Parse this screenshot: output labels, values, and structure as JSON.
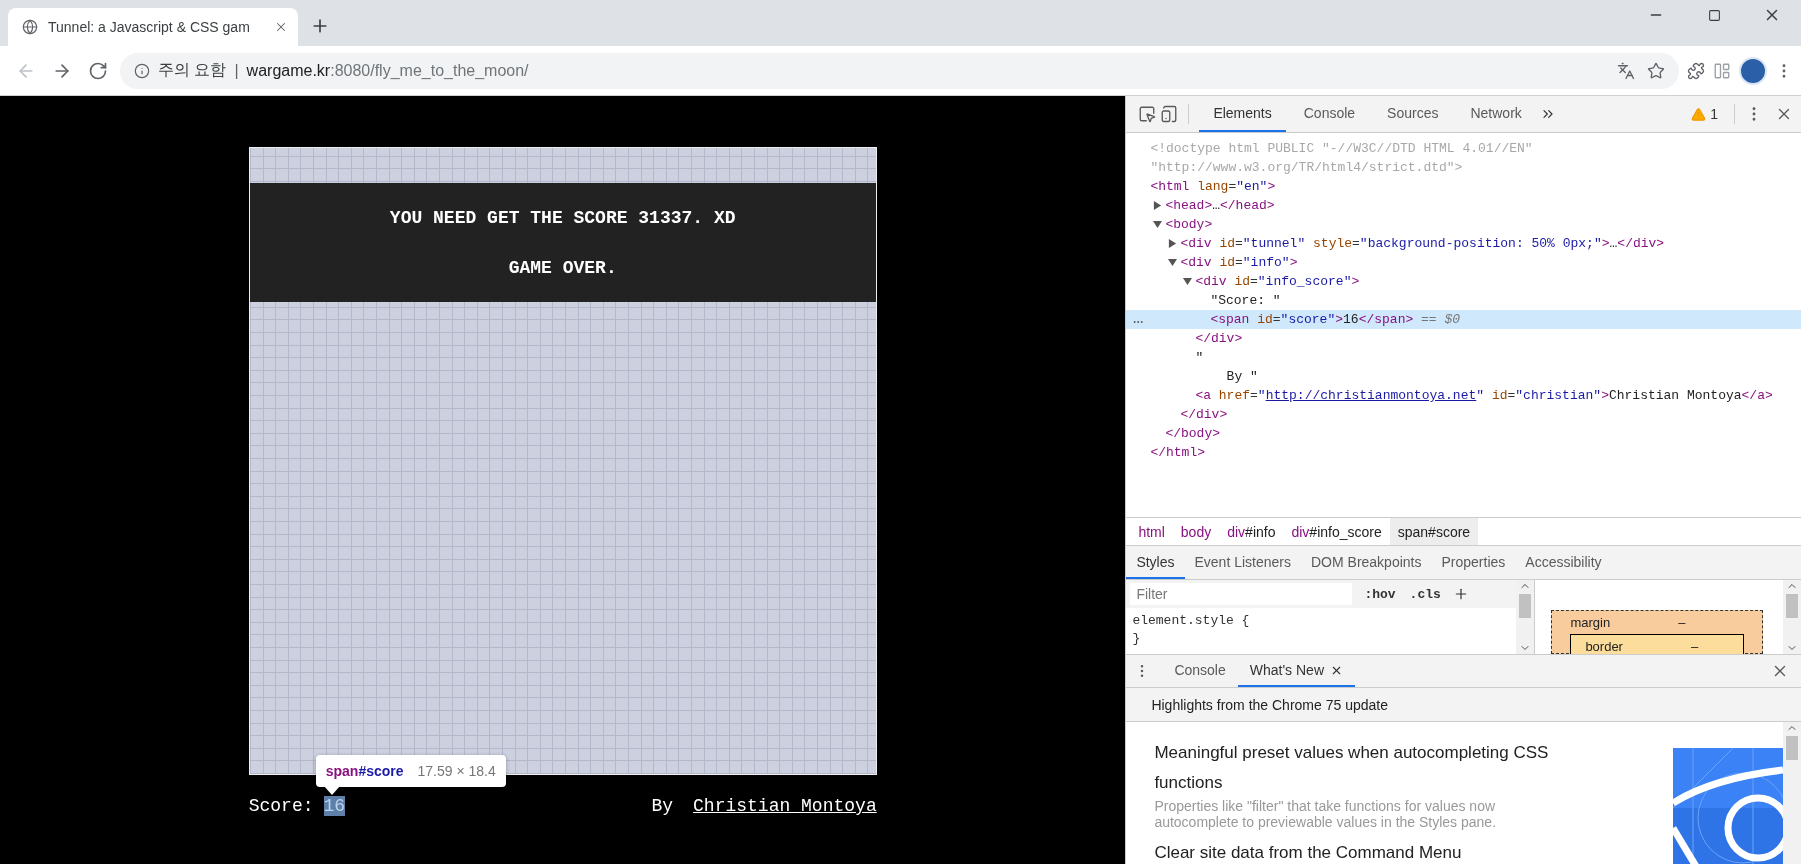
{
  "browser": {
    "tab": {
      "title": "Tunnel: a Javascript & CSS gam"
    },
    "nav": [
      {
        "kind": "back",
        "disabled": true
      },
      {
        "kind": "forward",
        "disabled": false
      },
      {
        "kind": "reload",
        "disabled": false
      }
    ],
    "address": {
      "warning": "주의 요함",
      "separator": "|",
      "host": "wargame.kr",
      "path": ":8080/fly_me_to_the_moon/"
    }
  },
  "game": {
    "messages": [
      "YOU NEED GET THE SCORE 31337. XD",
      "GAME OVER."
    ],
    "score_label": "Score:",
    "score": "16",
    "score_highlighted": true,
    "by": "By",
    "author": "Christian Montoya",
    "tooltip": {
      "tag": "span",
      "id": "#score",
      "size": "17.59 × 18.4"
    }
  },
  "devtools": {
    "tabs": [
      {
        "label": "Elements",
        "selected": true
      },
      {
        "label": "Console",
        "selected": false
      },
      {
        "label": "Sources",
        "selected": false
      },
      {
        "label": "Network",
        "selected": false
      }
    ],
    "warnings": "1",
    "dom": [
      {
        "selected": false,
        "lines": [
          [
            {
              "kind": "doctype",
              "text": "<!doctype html PUBLIC \"-//W3C//DTD HTML 4.01//EN\""
            }
          ],
          [
            {
              "kind": "doctype",
              "text": "\"http://www.w3.org/TR/html4/strict.dtd\">"
            }
          ]
        ]
      },
      {
        "selected": false,
        "lines": [
          [
            {
              "kind": "tag",
              "text": "<html"
            },
            {
              "kind": "attr",
              "text": " lang"
            },
            {
              "kind": "eq",
              "text": "="
            },
            {
              "kind": "value",
              "text": "\"en\""
            },
            {
              "kind": "tag",
              "text": ">"
            }
          ]
        ],
        "close": [
          {
            "kind": "tag",
            "text": "</html>"
          }
        ],
        "children": [
          {
            "selected": false,
            "expanded": false,
            "lines": [
              [
                {
                  "kind": "tag",
                  "text": "<head>"
                },
                {
                  "kind": "text",
                  "text": "…"
                },
                {
                  "kind": "tag",
                  "text": "</head>"
                }
              ]
            ]
          },
          {
            "selected": false,
            "expanded": true,
            "lines": [
              [
                {
                  "kind": "tag",
                  "text": "<body>"
                }
              ]
            ],
            "close": [
              {
                "kind": "tag",
                "text": "</body>"
              }
            ],
            "children": [
              {
                "selected": false,
                "expanded": false,
                "lines": [
                  [
                    {
                      "kind": "tag",
                      "text": "<div"
                    },
                    {
                      "kind": "attr",
                      "text": " id"
                    },
                    {
                      "kind": "eq",
                      "text": "="
                    },
                    {
                      "kind": "value",
                      "text": "\"tunnel\""
                    },
                    {
                      "kind": "attr",
                      "text": " style"
                    },
                    {
                      "kind": "eq",
                      "text": "="
                    },
                    {
                      "kind": "value",
                      "text": "\"background-position: 50% 0px;\""
                    },
                    {
                      "kind": "tag",
                      "text": ">"
                    },
                    {
                      "kind": "text",
                      "text": "…"
                    },
                    {
                      "kind": "tag",
                      "text": "</div>"
                    }
                  ]
                ]
              },
              {
                "selected": false,
                "expanded": true,
                "lines": [
                  [
                    {
                      "kind": "tag",
                      "text": "<div"
                    },
                    {
                      "kind": "attr",
                      "text": " id"
                    },
                    {
                      "kind": "eq",
                      "text": "="
                    },
                    {
                      "kind": "value",
                      "text": "\"info\""
                    },
                    {
                      "kind": "tag",
                      "text": ">"
                    }
                  ]
                ],
                "close": [
                  {
                    "kind": "tag",
                    "text": "</div>"
                  }
                ],
                "children": [
                  {
                    "selected": false,
                    "expanded": true,
                    "lines": [
                      [
                        {
                          "kind": "tag",
                          "text": "<div"
                        },
                        {
                          "kind": "attr",
                          "text": " id"
                        },
                        {
                          "kind": "eq",
                          "text": "="
                        },
                        {
                          "kind": "value",
                          "text": "\"info_score\""
                        },
                        {
                          "kind": "tag",
                          "text": ">"
                        }
                      ]
                    ],
                    "close": [
                      {
                        "kind": "tag",
                        "text": "</div>"
                      }
                    ],
                    "children": [
                      {
                        "selected": false,
                        "lines": [
                          [
                            {
                              "kind": "text",
                              "text": "\"Score: \""
                            }
                          ]
                        ]
                      },
                      {
                        "selected": true,
                        "lines": [
                          [
                            {
                              "kind": "tag",
                              "text": "<span"
                            },
                            {
                              "kind": "attr",
                              "text": " id"
                            },
                            {
                              "kind": "eq",
                              "text": "="
                            },
                            {
                              "kind": "value",
                              "text": "\"score\""
                            },
                            {
                              "kind": "tag",
                              "text": ">"
                            },
                            {
                              "kind": "text",
                              "text": "16"
                            },
                            {
                              "kind": "tag",
                              "text": "</span>"
                            },
                            {
                              "kind": "hint",
                              "text": " == $0"
                            }
                          ]
                        ]
                      }
                    ]
                  },
                  {
                    "selected": false,
                    "lines": [
                      [
                        {
                          "kind": "text",
                          "text": "\""
                        }
                      ],
                      [
                        {
                          "kind": "text",
                          "text": "    By \""
                        }
                      ]
                    ]
                  },
                  {
                    "selected": false,
                    "lines": [
                      [
                        {
                          "kind": "tag",
                          "text": "<a"
                        },
                        {
                          "kind": "attr",
                          "text": " href"
                        },
                        {
                          "kind": "eq",
                          "text": "="
                        },
                        {
                          "kind": "value",
                          "text": "\""
                        },
                        {
                          "kind": "link",
                          "text": "http://christianmontoya.net"
                        },
                        {
                          "kind": "value",
                          "text": "\""
                        },
                        {
                          "kind": "attr",
                          "text": " id"
                        },
                        {
                          "kind": "eq",
                          "text": "="
                        },
                        {
                          "kind": "value",
                          "text": "\"christian\""
                        },
                        {
                          "kind": "tag",
                          "text": ">"
                        },
                        {
                          "kind": "text",
                          "text": "Christian Montoya"
                        },
                        {
                          "kind": "tag",
                          "text": "</a>"
                        }
                      ]
                    ]
                  }
                ]
              }
            ]
          }
        ]
      }
    ],
    "breadcrumbs": [
      {
        "tag": "html",
        "selected": false
      },
      {
        "tag": "body",
        "selected": false
      },
      {
        "tag": "div",
        "suffix": "#info",
        "selected": false
      },
      {
        "tag": "div",
        "suffix": "#info_score",
        "selected": false
      },
      {
        "tag": "span",
        "suffix": "#score",
        "selected": true
      }
    ],
    "style_tabs": [
      {
        "label": "Styles",
        "selected": true
      },
      {
        "label": "Event Listeners",
        "selected": false
      },
      {
        "label": "DOM Breakpoints",
        "selected": false
      },
      {
        "label": "Properties",
        "selected": false
      },
      {
        "label": "Accessibility",
        "selected": false
      }
    ],
    "filter": {
      "placeholder": "Filter"
    },
    "style_buttons": [
      ":hov",
      ".cls"
    ],
    "rule": {
      "open": "element.style {",
      "close": "}"
    },
    "box_model": [
      {
        "label": "margin",
        "value": "–"
      },
      {
        "label": "border",
        "value": "–"
      }
    ],
    "drawer": {
      "tabs": [
        {
          "label": "Console",
          "selected": false,
          "closable": false
        },
        {
          "label": "What's New",
          "selected": true,
          "closable": true
        }
      ],
      "heading": "Highlights from the Chrome 75 update",
      "articles": [
        {
          "title": "Meaningful preset values when autocompleting CSS functions",
          "description": "Properties like \"filter\" that take functions for values now autocomplete to previewable values in the Styles pane."
        },
        {
          "title": "Clear site data from the Command Menu"
        }
      ]
    }
  }
}
